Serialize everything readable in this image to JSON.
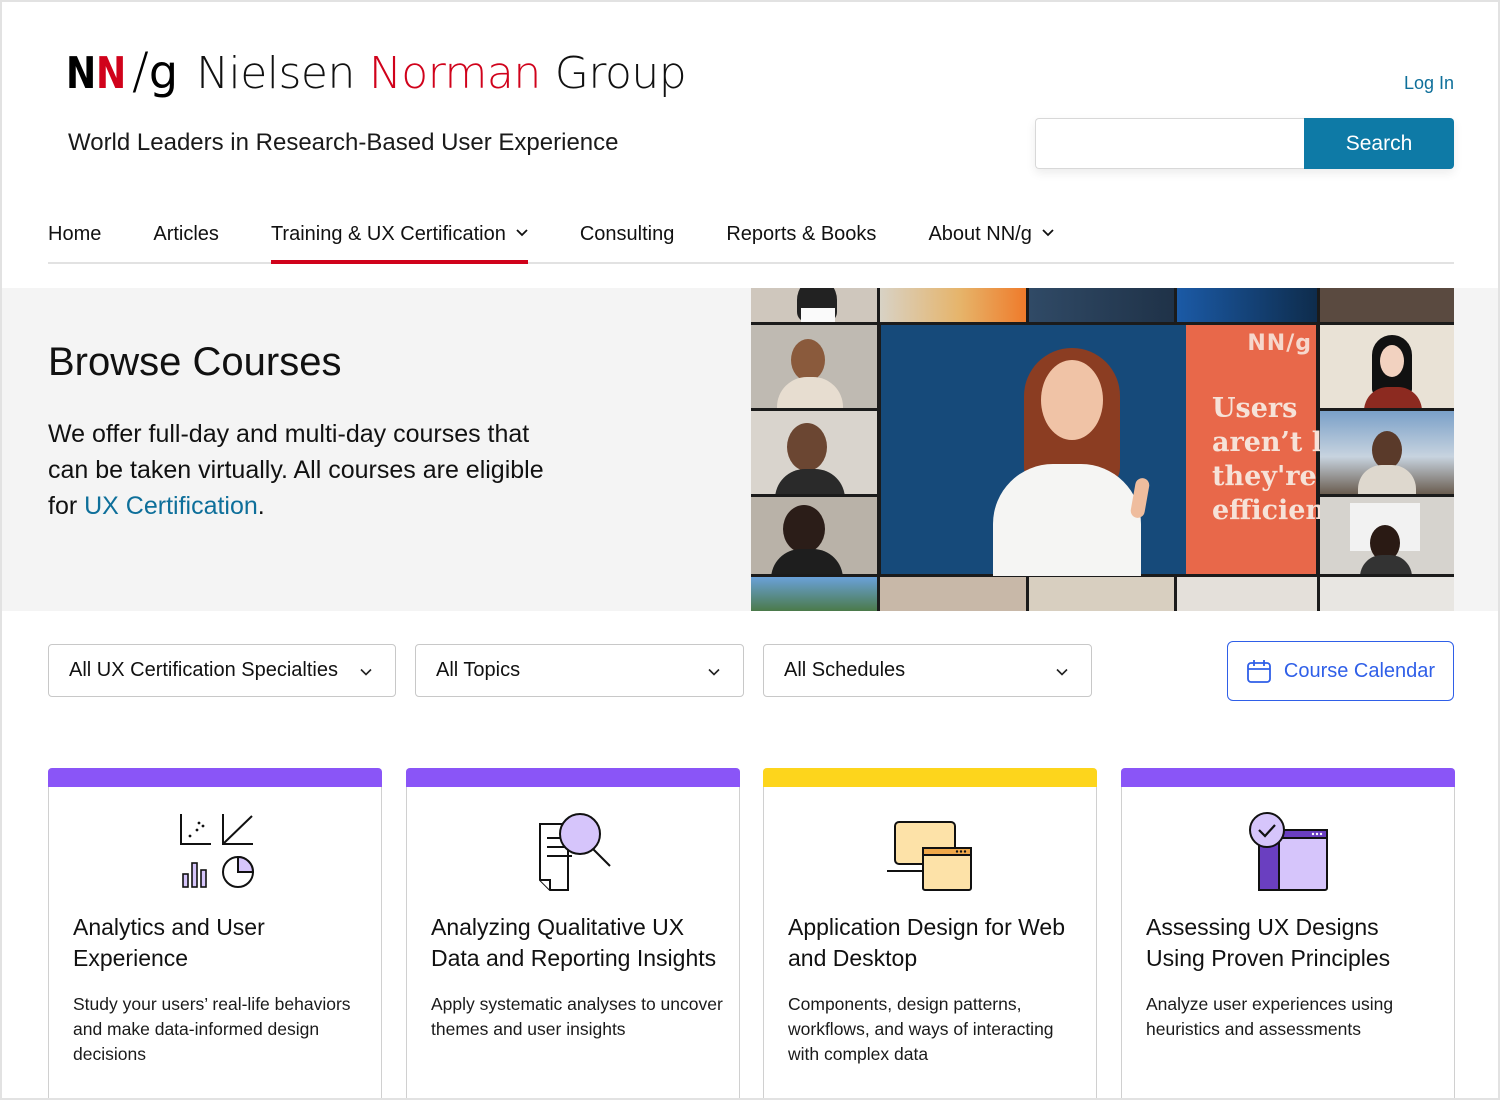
{
  "brand": {
    "logo_mark": [
      "N",
      "N",
      "/",
      "g"
    ],
    "name_words": [
      "Nielsen",
      "Norman",
      "Group"
    ],
    "tagline": "World Leaders in Research-Based User Experience",
    "colors": {
      "red": "#d0021b",
      "link_blue": "#0e6f9a",
      "button_blue": "#0e7aa6",
      "outline_blue": "#2f5fe8"
    }
  },
  "header": {
    "login_label": "Log In",
    "search": {
      "value": "",
      "placeholder": "",
      "button_label": "Search"
    }
  },
  "nav": {
    "items": [
      {
        "label": "Home",
        "has_dropdown": false,
        "active": false
      },
      {
        "label": "Articles",
        "has_dropdown": false,
        "active": false
      },
      {
        "label": "Training & UX Certification",
        "has_dropdown": true,
        "active": true
      },
      {
        "label": "Consulting",
        "has_dropdown": false,
        "active": false
      },
      {
        "label": "Reports & Books",
        "has_dropdown": false,
        "active": false
      },
      {
        "label": "About NN/g",
        "has_dropdown": true,
        "active": false
      }
    ]
  },
  "hero": {
    "title": "Browse Courses",
    "text_before_link": "We offer full-day and multi-day courses that can be taken virtually. All courses are eligible for ",
    "link_label": "UX Certification",
    "text_after_link": ".",
    "image": {
      "description": "Video-call grid of smiling course participants surrounding a presenter in front of an orange NN/g banner",
      "banner_logo": "NN/g",
      "banner_lines": [
        "Users",
        "aren’t la",
        "they're",
        "efficient"
      ]
    }
  },
  "filters": {
    "specialty": {
      "selected": "All UX Certification Specialties"
    },
    "topic": {
      "selected": "All Topics"
    },
    "schedule": {
      "selected": "All Schedules"
    },
    "calendar_button": {
      "label": "Course Calendar",
      "icon": "calendar-icon"
    }
  },
  "courses": [
    {
      "title": "Analytics and User Experience",
      "description": "Study your users’ real-life behaviors and make data-informed design decisions",
      "accent": "#8a55f7",
      "icon": "analytics-charts-icon"
    },
    {
      "title": "Analyzing Qualitative UX Data and Reporting Insights",
      "description": "Apply systematic analyses to uncover themes and user insights",
      "accent": "#8a55f7",
      "icon": "document-magnifier-icon"
    },
    {
      "title": "Application Design for Web and Desktop",
      "description": "Components, design patterns, workflows, and ways of interacting with complex data",
      "accent": "#fdd51c",
      "icon": "desktop-window-icon"
    },
    {
      "title": "Assessing UX Designs Using Proven Principles",
      "description": "Analyze user experiences using heuristics and assessments",
      "accent": "#8a55f7",
      "icon": "checkmark-window-icon"
    }
  ]
}
